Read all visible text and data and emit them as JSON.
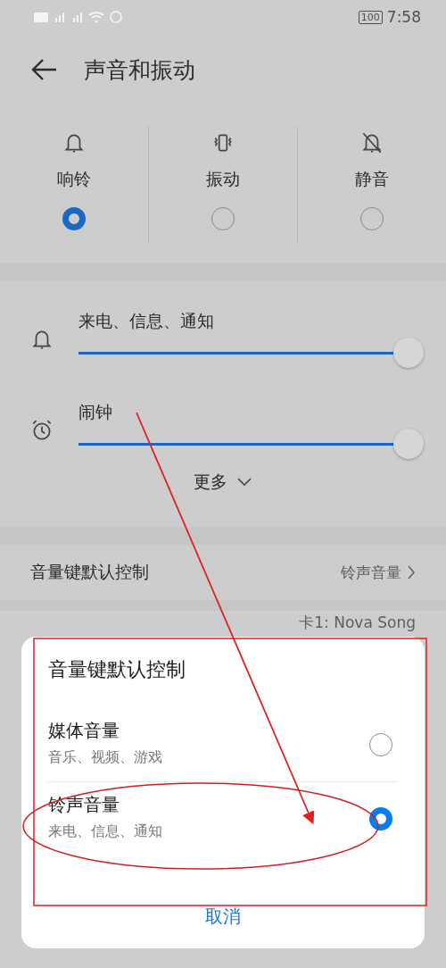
{
  "status_bar": {
    "battery": "100",
    "time": "7:58"
  },
  "header": {
    "title": "声音和振动"
  },
  "modes": [
    {
      "label": "响铃",
      "kind": "bell",
      "selected": true
    },
    {
      "label": "振动",
      "kind": "vibrate",
      "selected": false
    },
    {
      "label": "静音",
      "kind": "mute",
      "selected": false
    }
  ],
  "volumes": [
    {
      "label": "来电、信息、通知",
      "kind": "bell",
      "level": 1
    },
    {
      "label": "闹钟",
      "kind": "alarm",
      "level": 1
    }
  ],
  "more": "更多",
  "settings": [
    {
      "label": "音量键默认控制",
      "value": "铃声音量"
    },
    {
      "value": "卡1: Nova Song"
    }
  ],
  "dialog": {
    "title": "音量键默认控制",
    "options": [
      {
        "label": "媒体音量",
        "sub": "音乐、视频、游戏",
        "selected": false
      },
      {
        "label": "铃声音量",
        "sub": "来电、信息、通知",
        "selected": true
      }
    ],
    "cancel": "取消"
  }
}
